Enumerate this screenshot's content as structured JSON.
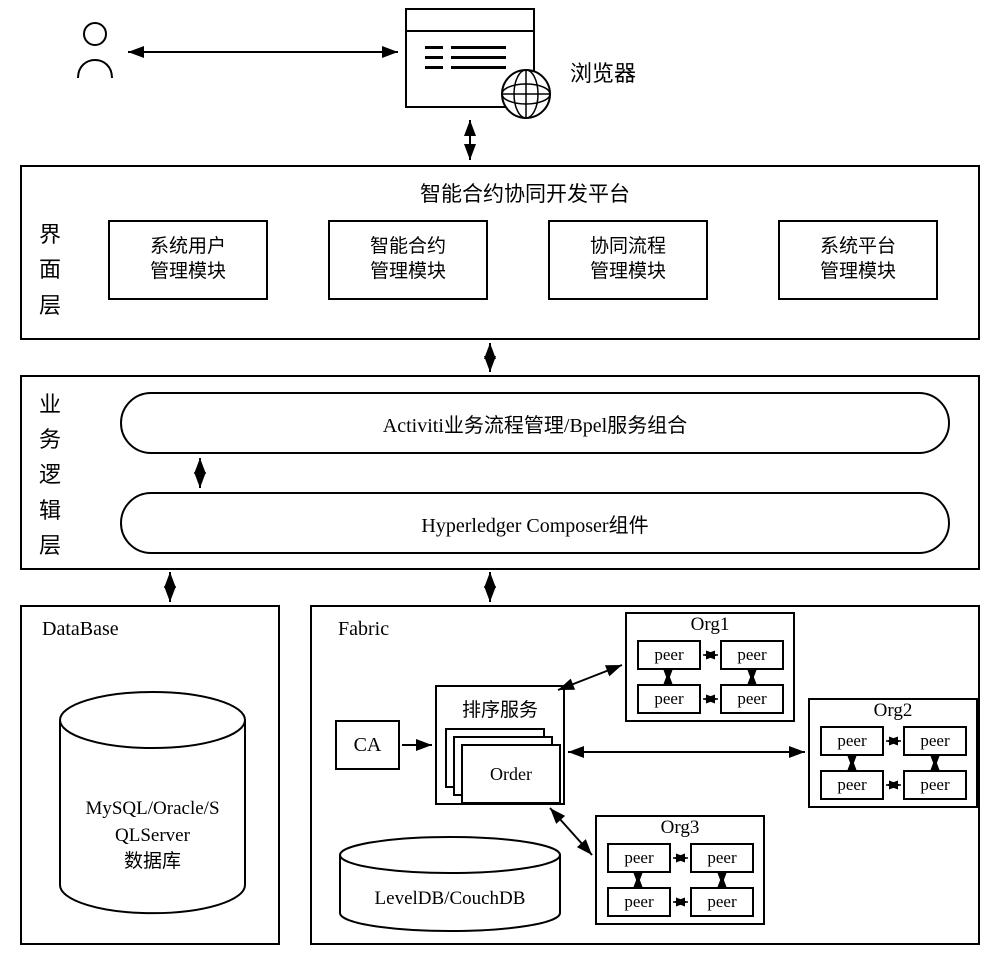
{
  "top": {
    "browser_label": "浏览器"
  },
  "layer1": {
    "side_label": "界面层",
    "title": "智能合约协同开发平台",
    "modules": [
      {
        "l1": "系统用户",
        "l2": "管理模块"
      },
      {
        "l1": "智能合约",
        "l2": "管理模块"
      },
      {
        "l1": "协同流程",
        "l2": "管理模块"
      },
      {
        "l1": "系统平台",
        "l2": "管理模块"
      }
    ]
  },
  "layer2": {
    "side_label": "业务逻辑层",
    "row1": "Activiti业务流程管理/Bpel服务组合",
    "row2": "Hyperledger Composer组件"
  },
  "bottom": {
    "db": {
      "title": "DataBase",
      "text_l1": "MySQL/Oracle/S",
      "text_l2": "QLServer",
      "text_l3": "数据库"
    },
    "fabric": {
      "title": "Fabric",
      "ca": "CA",
      "orderer_title": "排序服务",
      "orderer_box": "Order",
      "org1": {
        "title": "Org1",
        "peer": "peer"
      },
      "org2": {
        "title": "Org2",
        "peer": "peer"
      },
      "org3": {
        "title": "Org3",
        "peer": "peer"
      },
      "ledger_db": "LevelDB/CouchDB"
    }
  }
}
